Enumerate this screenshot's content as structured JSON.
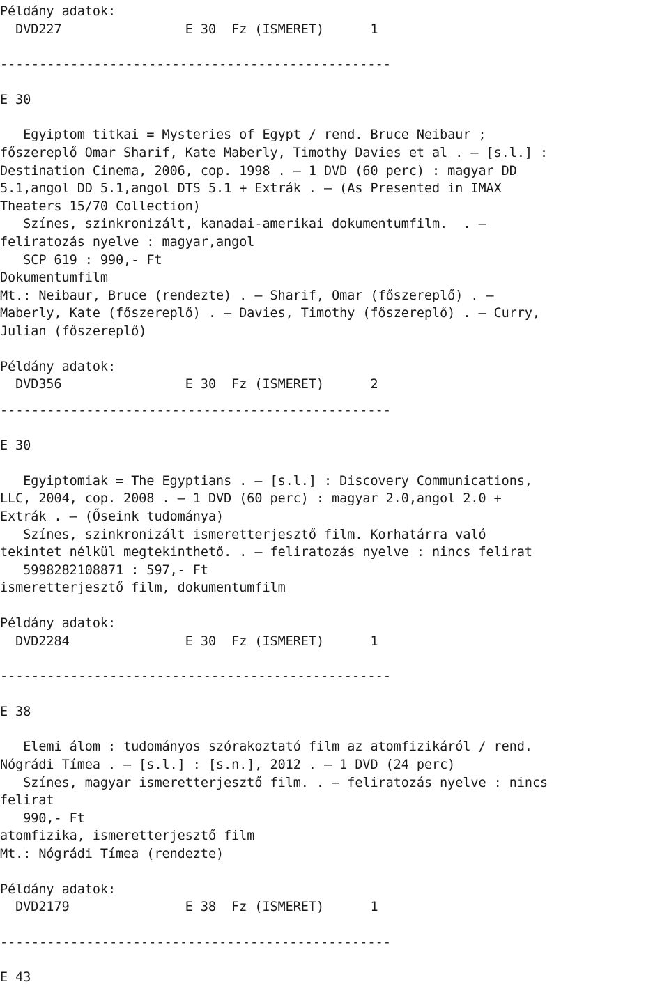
{
  "document": {
    "kind": "library-catalog-printout",
    "language": "hu",
    "separator_rule": "--------------------------------------------------",
    "copy_data_label": "Példány adatok:"
  },
  "blocks": [
    {
      "id": "copy-block-0",
      "type": "copy-data",
      "label": "Példány adatok:",
      "row": "  DVD227                E 30  Fz (ISMERET)      1"
    },
    {
      "id": "rule-0",
      "type": "rule",
      "text": "--------------------------------------------------"
    },
    {
      "id": "section-e30-a",
      "type": "record",
      "shelfmark": "E 30",
      "body": "   Egyiptom titkai = Mysteries of Egypt / rend. Bruce Neibaur ;\nfőszereplő Omar Sharif, Kate Maberly, Timothy Davies et al . — [s.l.] :\nDestination Cinema, 2006, cop. 1998 . — 1 DVD (60 perc) : magyar DD\n5.1,angol DD 5.1,angol DTS 5.1 + Extrák . — (As Presented in IMAX\nTheaters 15/70 Collection)\n   Színes, szinkronizált, kanadai-amerikai dokumentumfilm.  . —\nfeliratozás nyelve : magyar,angol\n   SCP 619 : 990,- Ft\nDokumentumfilm\nMt.: Neibaur, Bruce (rendezte) . — Sharif, Omar (főszereplő) . —\nMaberly, Kate (főszereplő) . — Davies, Timothy (főszereplő) . — Curry,\nJulian (főszereplő)"
    },
    {
      "id": "copy-block-1",
      "type": "copy-data",
      "label": "Példány adatok:",
      "row": "  DVD356                E 30  Fz (ISMERET)      2"
    },
    {
      "id": "rule-1",
      "type": "rule",
      "text": "--------------------------------------------------"
    },
    {
      "id": "section-e30-b",
      "type": "record",
      "shelfmark": "E 30",
      "body": "   Egyiptomiak = The Egyptians . — [s.l.] : Discovery Communications,\nLLC, 2004, cop. 2008 . — 1 DVD (60 perc) : magyar 2.0,angol 2.0 +\nExtrák . — (Őseink tudománya)\n   Színes, szinkronizált ismeretterjesztő film. Korhatárra való\ntekintet nélkül megtekinthető. . — feliratozás nyelve : nincs felirat\n   5998282108871 : 597,- Ft\nismeretterjesztő film, dokumentumfilm"
    },
    {
      "id": "copy-block-2",
      "type": "copy-data",
      "label": "Példány adatok:",
      "row": "  DVD2284               E 30  Fz (ISMERET)      1"
    },
    {
      "id": "rule-2",
      "type": "rule",
      "text": "--------------------------------------------------"
    },
    {
      "id": "section-e38",
      "type": "record",
      "shelfmark": "E 38",
      "body": "   Elemi álom : tudományos szórakoztató film az atomfizikáról / rend.\nNógrádi Tímea . — [s.l.] : [s.n.], 2012 . — 1 DVD (24 perc)\n   Színes, magyar ismeretterjesztő film. . — feliratozás nyelve : nincs\nfelirat\n   990,- Ft\natomfizika, ismeretterjesztő film\nMt.: Nógrádi Tímea (rendezte)"
    },
    {
      "id": "copy-block-3",
      "type": "copy-data",
      "label": "Példány adatok:",
      "row": "  DVD2179               E 38  Fz (ISMERET)      1"
    },
    {
      "id": "rule-3",
      "type": "rule",
      "text": "--------------------------------------------------"
    },
    {
      "id": "section-e43",
      "type": "record-heading-only",
      "shelfmark": "E 43",
      "body": ""
    }
  ],
  "records": [
    {
      "shelfmark": "E 30",
      "title": "Egyiptom titkai = Mysteries of Egypt",
      "director": "Bruce Neibaur",
      "cast": [
        "Omar Sharif",
        "Kate Maberly",
        "Timothy Davies"
      ],
      "cast_note": "et al",
      "place": "[s.l.]",
      "publisher": "Destination Cinema",
      "year": "2006",
      "copyright": "cop. 1998",
      "extent": "1 DVD (60 perc)",
      "audio": "magyar DD 5.1,angol DD 5.1,angol DTS 5.1 + Extrák",
      "series": "(As Presented in IMAX Theaters 15/70 Collection)",
      "note": "Színes, szinkronizált, kanadai-amerikai dokumentumfilm.",
      "subtitles": "feliratozás nyelve : magyar,angol",
      "identifier": "SCP 619",
      "price": "990,- Ft",
      "subject": "Dokumentumfilm",
      "added_entries": "Mt.: Neibaur, Bruce (rendezte) . — Sharif, Omar (főszereplő) . — Maberly, Kate (főszereplő) . — Davies, Timothy (főszereplő) . — Curry, Julian (főszereplő)",
      "copies": [
        {
          "barcode": "DVD227",
          "shelfmark": "E 30",
          "binding": "Fz",
          "collection": "(ISMERET)",
          "count": "1"
        },
        {
          "barcode": "DVD356",
          "shelfmark": "E 30",
          "binding": "Fz",
          "collection": "(ISMERET)",
          "count": "2"
        }
      ]
    },
    {
      "shelfmark": "E 30",
      "title": "Egyiptomiak = The Egyptians",
      "place": "[s.l.]",
      "publisher": "Discovery Communications, LLC",
      "year": "2004",
      "copyright": "cop. 2008",
      "extent": "1 DVD (60 perc)",
      "audio": "magyar 2.0,angol 2.0 + Extrák",
      "series": "(Őseink tudománya)",
      "note": "Színes, szinkronizált ismeretterjesztő film. Korhatárra való tekintet nélkül megtekinthető.",
      "subtitles": "feliratozás nyelve : nincs felirat",
      "identifier": "5998282108871",
      "price": "597,- Ft",
      "subject": "ismeretterjesztő film, dokumentumfilm",
      "copies": [
        {
          "barcode": "DVD2284",
          "shelfmark": "E 30",
          "binding": "Fz",
          "collection": "(ISMERET)",
          "count": "1"
        }
      ]
    },
    {
      "shelfmark": "E 38",
      "title": "Elemi álom : tudományos szórakoztató film az atomfizikáról",
      "director": "Nógrádi Tímea",
      "place": "[s.l.]",
      "publisher": "[s.n.]",
      "year": "2012",
      "extent": "1 DVD (24 perc)",
      "note": "Színes, magyar ismeretterjesztő film.",
      "subtitles": "feliratozás nyelve : nincs felirat",
      "price": "990,- Ft",
      "subject": "atomfizika, ismeretterjesztő film",
      "added_entries": "Mt.: Nógrádi Tímea (rendezte)",
      "copies": [
        {
          "barcode": "DVD2179",
          "shelfmark": "E 38",
          "binding": "Fz",
          "collection": "(ISMERET)",
          "count": "1"
        }
      ]
    },
    {
      "shelfmark": "E 43",
      "title": "",
      "copies": []
    }
  ]
}
